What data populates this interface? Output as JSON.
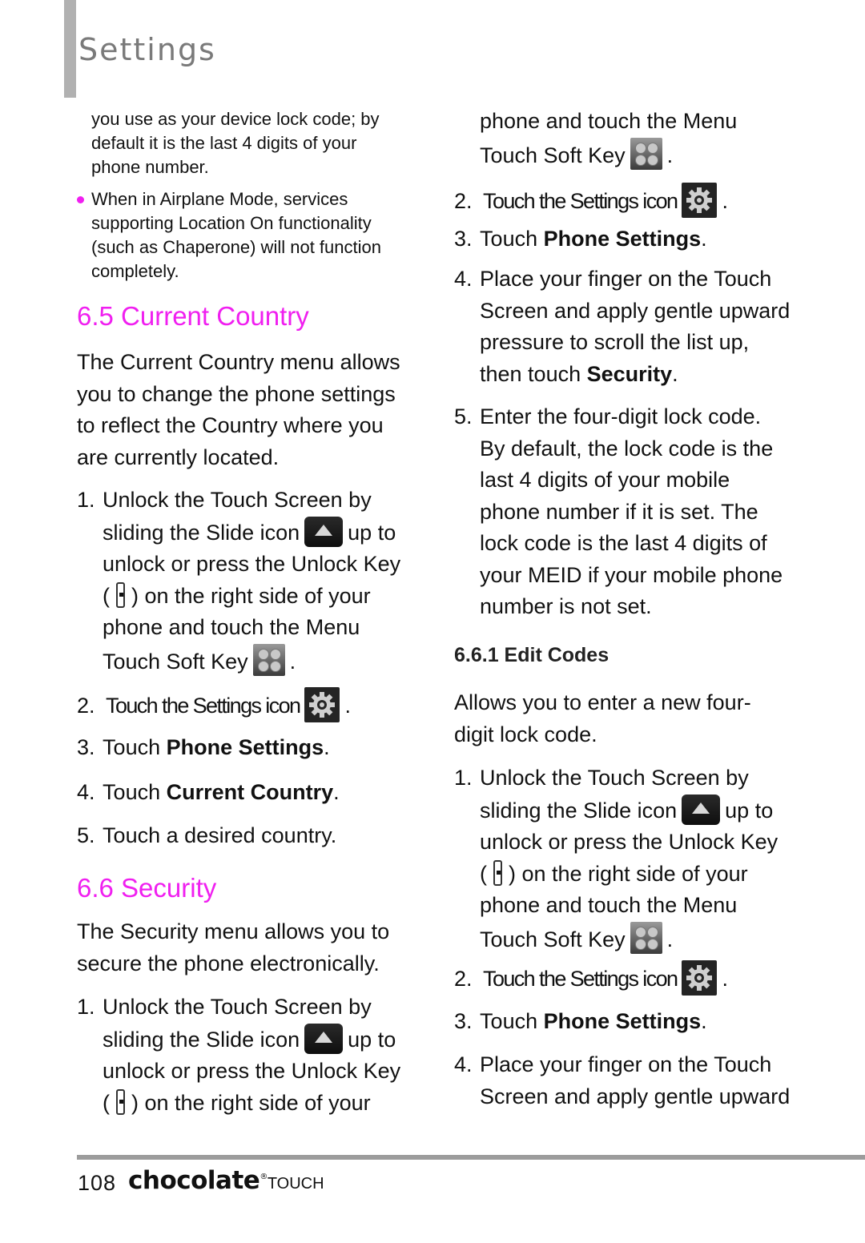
{
  "header": {
    "title": "Settings"
  },
  "left": {
    "intro_lines": [
      "you use as your device lock code; by",
      "default it is the last 4 digits of your",
      "phone number."
    ],
    "bullet_lines": [
      "When in Airplane Mode, services",
      "supporting Location On functionality",
      "(such as Chaperone) will not function",
      "completely."
    ],
    "section_65": {
      "heading": "6.5 Current Country",
      "desc_lines": [
        "The Current Country menu allows",
        "you to change the phone settings",
        "to reflect the Country where you",
        "are currently located."
      ],
      "step1": {
        "num": "1.",
        "l1": "Unlock the Touch Screen by",
        "l2a": "sliding the Slide icon",
        "l2b": "up to",
        "l3": "unlock or press the Unlock Key",
        "l4a": "(",
        "l4b": ") on the right side of your",
        "l5": "phone and touch the Menu",
        "l6a": "Touch Soft Key",
        "l6b": "."
      },
      "step2": {
        "num": "2.",
        "text": "Touch the Settings icon",
        "end": "."
      },
      "step3": {
        "num": "3.",
        "pre": "Touch ",
        "bold": "Phone Settings",
        "end": "."
      },
      "step4": {
        "num": "4.",
        "pre": "Touch ",
        "bold": "Current Country",
        "end": "."
      },
      "step5": {
        "num": "5.",
        "text": "Touch a desired country."
      }
    },
    "section_66": {
      "heading": "6.6 Security",
      "desc_lines": [
        "The Security menu allows you to",
        "secure the phone electronically."
      ],
      "step1": {
        "num": "1.",
        "l1": "Unlock the Touch Screen by",
        "l2a": "sliding the Slide icon",
        "l2b": "up to",
        "l3": "unlock or press the Unlock Key",
        "l4a": "(",
        "l4b": ") on the right side of your"
      }
    }
  },
  "right": {
    "cont": {
      "l1": "phone and touch the Menu",
      "l2a": "Touch Soft Key",
      "l2b": "."
    },
    "step2": {
      "num": "2.",
      "text": "Touch the Settings icon",
      "end": "."
    },
    "step3": {
      "num": "3.",
      "pre": "Touch ",
      "bold": "Phone Settings",
      "end": "."
    },
    "step4": {
      "num": "4.",
      "lines": [
        "Place your finger on the Touch",
        "Screen and apply gentle upward",
        "pressure to scroll the list up,"
      ],
      "last_pre": "then touch ",
      "last_bold": "Security",
      "last_end": "."
    },
    "step5": {
      "num": "5.",
      "lines": [
        "Enter the four-digit lock code.",
        "By default, the lock code is the",
        "last 4 digits of your mobile",
        "phone number if it is set. The",
        "lock code is the last 4 digits of",
        "your MEID if your mobile phone",
        "number is not set."
      ]
    },
    "section_661": {
      "heading": "6.6.1 Edit Codes",
      "desc_lines": [
        "Allows you to enter a new four-",
        "digit lock code."
      ],
      "step1": {
        "num": "1.",
        "l1": "Unlock the Touch Screen by",
        "l2a": "sliding the Slide icon",
        "l2b": "up to",
        "l3": "unlock or press the Unlock Key",
        "l4a": "(",
        "l4b": ") on the right side of your",
        "l5": "phone and touch the Menu",
        "l6a": "Touch Soft Key",
        "l6b": "."
      },
      "step2": {
        "num": "2.",
        "text": "Touch the Settings icon",
        "end": "."
      },
      "step3": {
        "num": "3.",
        "pre": "Touch ",
        "bold": "Phone Settings",
        "end": "."
      },
      "step4": {
        "num": "4.",
        "lines": [
          "Place your finger on the Touch",
          "Screen and apply gentle upward"
        ]
      }
    }
  },
  "footer": {
    "page_number": "108",
    "brand": "chocolate",
    "reg": "®",
    "product": "TOUCH"
  },
  "colors": {
    "accent": "#f01ff0",
    "header_bar": "#b1b1b1",
    "header_text": "#7a7a7a",
    "rule": "#9c9c9c"
  }
}
